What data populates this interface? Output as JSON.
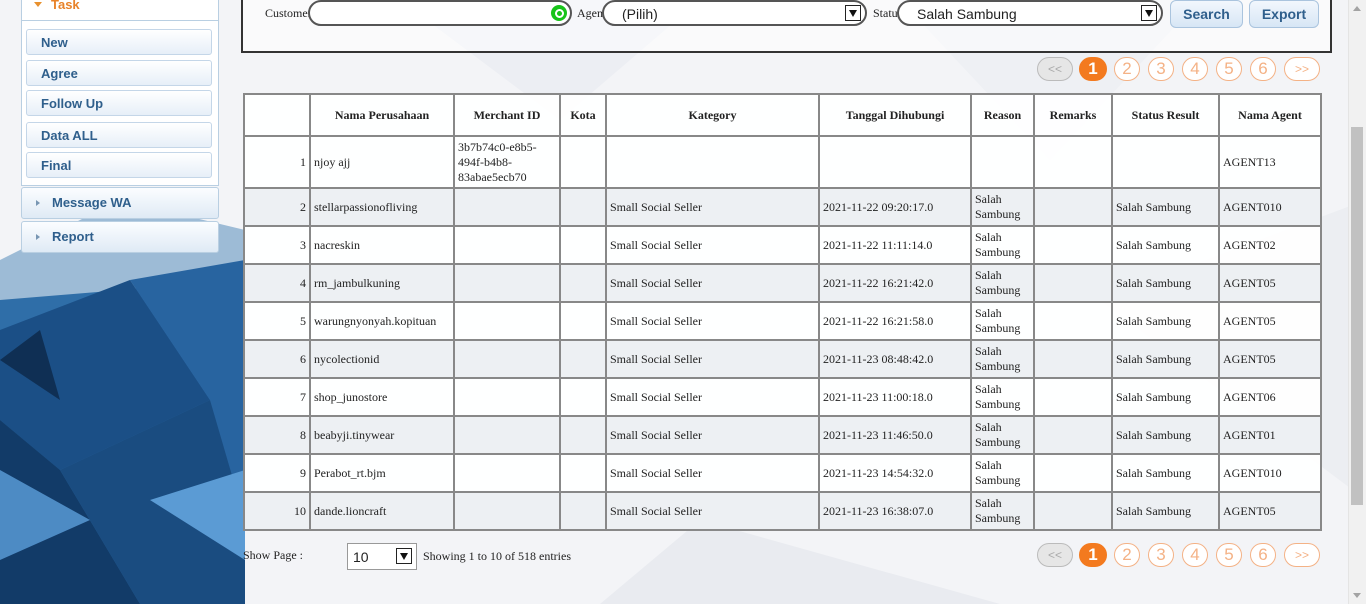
{
  "sidebar": {
    "task_label": "Task",
    "sub_items": [
      {
        "label": "New"
      },
      {
        "label": "Agree"
      },
      {
        "label": "Follow Up"
      },
      {
        "label": "Data ALL"
      },
      {
        "label": "Final"
      }
    ],
    "menus": [
      {
        "label": "Message WA"
      },
      {
        "label": "Report"
      }
    ]
  },
  "filters": {
    "customer_label": "Customer",
    "customer_value": "",
    "agent_label": "Agent",
    "agent_value": "(Pilih)",
    "status_label": "Status",
    "status_value": "Salah Sambung",
    "search_label": "Search",
    "export_label": "Export"
  },
  "pagination": {
    "prev": "<<",
    "next": ">>",
    "pages": [
      "1",
      "2",
      "3",
      "4",
      "5",
      "6"
    ],
    "current": "1"
  },
  "table": {
    "headers": [
      "",
      "Nama Perusahaan",
      "Merchant ID",
      "Kota",
      "Kategory",
      "Tanggal Dihubungi",
      "Reason",
      "Remarks",
      "Status Result",
      "Nama Agent"
    ],
    "rows": [
      [
        "1",
        "njoy ajj",
        "3b7b74c0-e8b5-494f-b4b8-83abae5ecb70",
        "",
        "",
        "",
        "",
        "",
        "",
        "AGENT13"
      ],
      [
        "2",
        "stellarpassionofliving",
        "",
        "",
        "Small Social Seller",
        "2021-11-22 09:20:17.0",
        "Salah Sambung",
        "",
        "Salah Sambung",
        "AGENT010"
      ],
      [
        "3",
        "nacreskin",
        "",
        "",
        "Small Social Seller",
        "2021-11-22 11:11:14.0",
        "Salah Sambung",
        "",
        "Salah Sambung",
        "AGENT02"
      ],
      [
        "4",
        "rm_jambulkuning",
        "",
        "",
        "Small Social Seller",
        "2021-11-22 16:21:42.0",
        "Salah Sambung",
        "",
        "Salah Sambung",
        "AGENT05"
      ],
      [
        "5",
        "warungnyonyah.kopituan",
        "",
        "",
        "Small Social Seller",
        "2021-11-22 16:21:58.0",
        "Salah Sambung",
        "",
        "Salah Sambung",
        "AGENT05"
      ],
      [
        "6",
        "nycolectionid",
        "",
        "",
        "Small Social Seller",
        "2021-11-23 08:48:42.0",
        "Salah Sambung",
        "",
        "Salah Sambung",
        "AGENT05"
      ],
      [
        "7",
        "shop_junostore",
        "",
        "",
        "Small Social Seller",
        "2021-11-23 11:00:18.0",
        "Salah Sambung",
        "",
        "Salah Sambung",
        "AGENT06"
      ],
      [
        "8",
        "beabyji.tinywear",
        "",
        "",
        "Small Social Seller",
        "2021-11-23 11:46:50.0",
        "Salah Sambung",
        "",
        "Salah Sambung",
        "AGENT01"
      ],
      [
        "9",
        "Perabot_rt.bjm",
        "",
        "",
        "Small Social Seller",
        "2021-11-23 14:54:32.0",
        "Salah Sambung",
        "",
        "Salah Sambung",
        "AGENT010"
      ],
      [
        "10",
        "dande.lioncraft",
        "",
        "",
        "Small Social Seller",
        "2021-11-23 16:38:07.0",
        "Salah Sambung",
        "",
        "Salah Sambung",
        "AGENT05"
      ]
    ]
  },
  "footer": {
    "show_page_label": "Show Page :",
    "page_size": "10",
    "entries_text": "Showing 1 to 10 of 518 entries"
  },
  "colors": {
    "accent_orange": "#f37a1f",
    "link_blue": "#2f5f8c"
  }
}
